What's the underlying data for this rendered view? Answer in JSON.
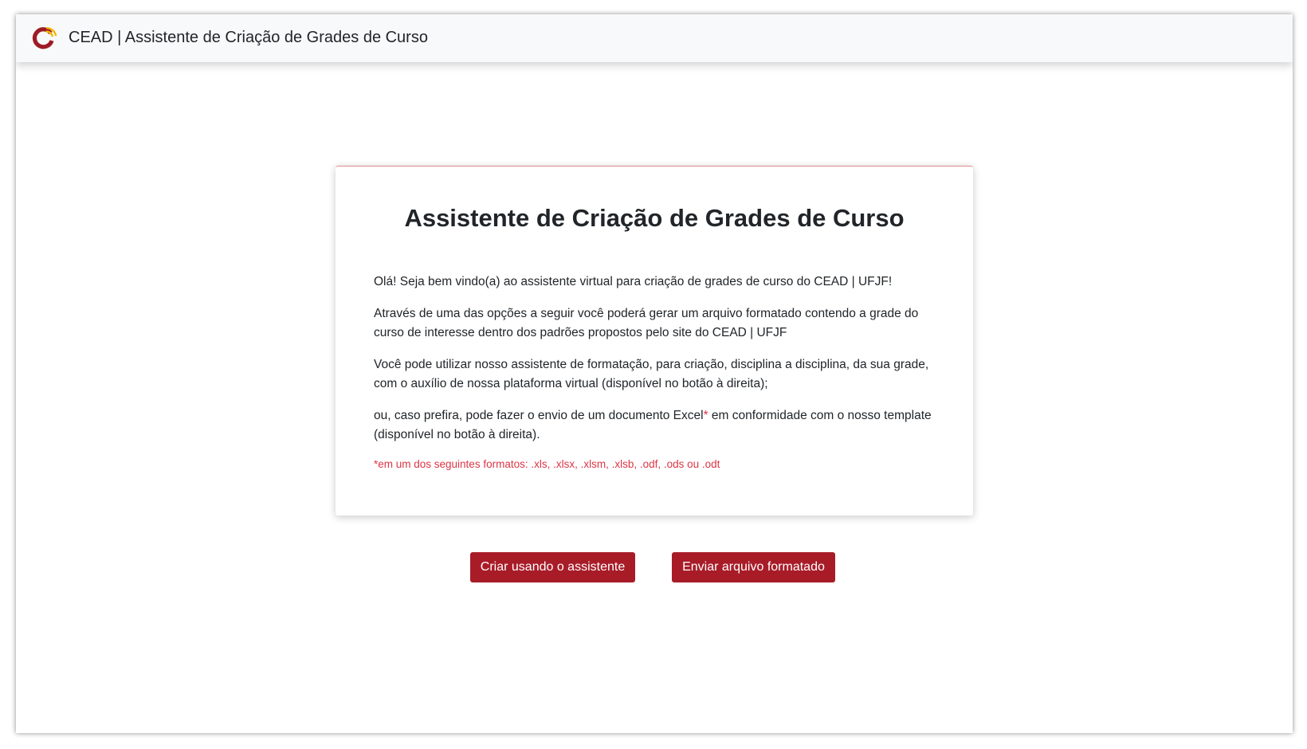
{
  "navbar": {
    "logo_icon": "cead-logo-icon",
    "title": "CEAD | Assistente de Criação de Grades de Curso"
  },
  "card": {
    "title": "Assistente de Criação de Grades de Curso",
    "paragraph1": "Olá! Seja bem vindo(a) ao assistente virtual para criação de grades de curso do CEAD | UFJF!",
    "paragraph2": "Através de uma das opções a seguir você poderá gerar um arquivo formatado contendo a grade do curso de interesse dentro dos padrões propostos pelo site do CEAD | UFJF",
    "paragraph3": "Você pode utilizar nosso assistente de formatação, para criação, disciplina a disciplina, da sua grade, com o auxílio de nossa plataforma virtual (disponível no botão à direita);",
    "paragraph4_before": "ou, caso prefira, pode fazer o envio de um documento Excel",
    "paragraph4_asterisk": "*",
    "paragraph4_after": " em conformidade com o nosso template (disponível no botão à direita).",
    "footnote": "*em um dos seguintes formatos: .xls, .xlsx, .xlsm, .xlsb, .odf, .ods ou .odt"
  },
  "actions": {
    "create_with_assistant_label": "Criar usando o assistente",
    "send_formatted_file_label": "Enviar arquivo formatado"
  },
  "colors": {
    "brand_red": "#a81c28",
    "logo_red": "#9e1b24",
    "logo_yellow": "#f2b705",
    "footnote_red": "#dc3545",
    "navbar_bg": "#f8f9fa"
  }
}
